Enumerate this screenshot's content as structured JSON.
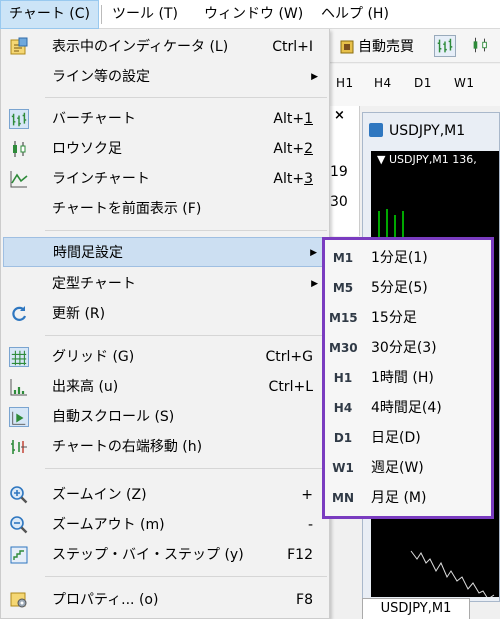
{
  "menubar": {
    "items": [
      {
        "label": "チャート (C)",
        "active": true
      },
      {
        "label": "ツール (T)",
        "active": false
      },
      {
        "label": "ウィンドウ (W)",
        "active": false
      },
      {
        "label": "ヘルプ (H)",
        "active": false
      }
    ]
  },
  "toolbar": {
    "auto_trade_label": "自動売買"
  },
  "timeframe_strip": [
    "H1",
    "H4",
    "D1",
    "W1"
  ],
  "chart_window": {
    "title": "USDJPY,M1",
    "label": "▼ USDJPY,M1  136,"
  },
  "side_panel": {
    "close": "×",
    "numbers": [
      "19",
      "30"
    ]
  },
  "bottom_tab": "USDJPY,M1",
  "menu": {
    "items": [
      {
        "label": "表示中のインディケータ (L)",
        "accel": "Ctrl+I",
        "icon": "indicator-list-icon"
      },
      {
        "label": "ライン等の設定",
        "arrow": "▶"
      },
      {
        "label": "バーチャート",
        "accel_prefix": "Alt+",
        "accel_digit": "1",
        "icon": "bar-chart-icon"
      },
      {
        "label": "ロウソク足",
        "accel_prefix": "Alt+",
        "accel_digit": "2",
        "icon": "candlestick-icon"
      },
      {
        "label": "ラインチャート",
        "accel_prefix": "Alt+",
        "accel_digit": "3",
        "icon": "line-chart-icon"
      },
      {
        "label": "チャートを前面表示 (F)"
      },
      {
        "label": "時間足設定",
        "arrow": "▶"
      },
      {
        "label": "定型チャート",
        "arrow": "▶"
      },
      {
        "label": "更新 (R)",
        "icon": "refresh-icon"
      },
      {
        "label": "グリッド (G)",
        "accel": "Ctrl+G",
        "icon": "grid-icon"
      },
      {
        "label": "出来高 (u)",
        "accel": "Ctrl+L",
        "icon": "volume-icon"
      },
      {
        "label": "自動スクロール (S)",
        "icon": "auto-scroll-icon"
      },
      {
        "label": "チャートの右端移動 (h)",
        "icon": "chart-shift-icon"
      },
      {
        "label": "ズームイン (Z)",
        "accel": "+",
        "icon": "zoom-in-icon"
      },
      {
        "label": "ズームアウト (m)",
        "accel": "-",
        "icon": "zoom-out-icon"
      },
      {
        "label": "ステップ・バイ・ステップ (y)",
        "accel": "F12",
        "icon": "step-by-step-icon"
      },
      {
        "label": "プロパティ... (o)",
        "accel": "F8",
        "icon": "properties-icon"
      }
    ]
  },
  "submenu": {
    "items": [
      {
        "tag": "M1",
        "label": "1分足(1)"
      },
      {
        "tag": "M5",
        "label": "5分足(5)"
      },
      {
        "tag": "M15",
        "label": "15分足"
      },
      {
        "tag": "M30",
        "label": "30分足(3)"
      },
      {
        "tag": "H1",
        "label": "1時間 (H)"
      },
      {
        "tag": "H4",
        "label": "4時間足(4)"
      },
      {
        "tag": "D1",
        "label": "日足(D)"
      },
      {
        "tag": "W1",
        "label": "週足(W)"
      },
      {
        "tag": "MN",
        "label": "月足 (M)"
      }
    ],
    "border_color": "#7a3cc0"
  },
  "colors": {
    "highlight": "#ccdff2",
    "icon_green": "#2e8b3a",
    "icon_blue": "#2f77c0"
  }
}
